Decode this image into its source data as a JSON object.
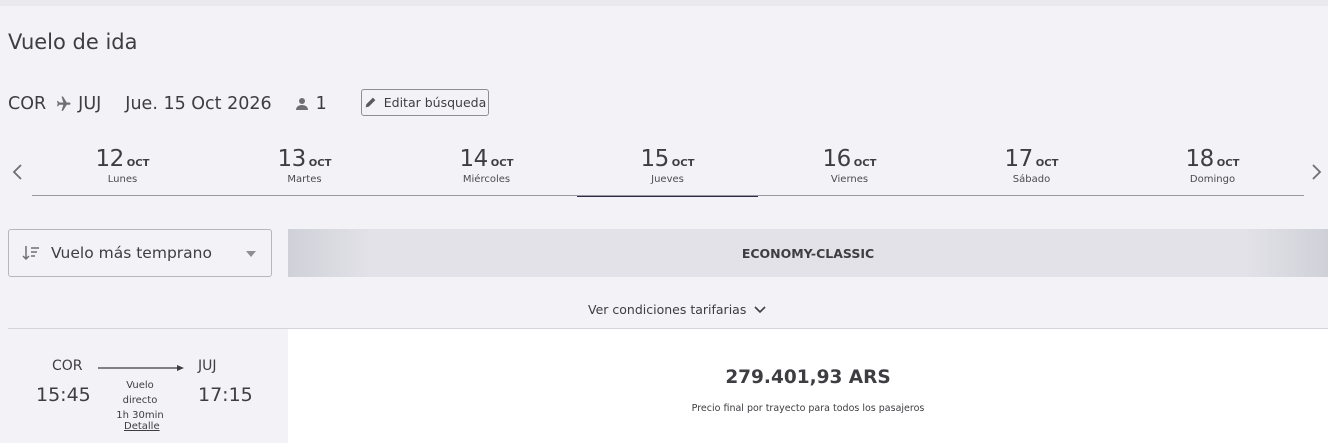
{
  "page": {
    "title": "Vuelo de ida"
  },
  "search": {
    "origin": "COR",
    "destination": "JUJ",
    "date": "Jue. 15 Oct 2026",
    "passengers": "1",
    "edit_label": "Editar búsqueda"
  },
  "dates": [
    {
      "day": "12",
      "month": "OCT",
      "weekday": "Lunes"
    },
    {
      "day": "13",
      "month": "OCT",
      "weekday": "Martes"
    },
    {
      "day": "14",
      "month": "OCT",
      "weekday": "Miércoles"
    },
    {
      "day": "15",
      "month": "OCT",
      "weekday": "Jueves",
      "selected": true
    },
    {
      "day": "16",
      "month": "OCT",
      "weekday": "Viernes"
    },
    {
      "day": "17",
      "month": "OCT",
      "weekday": "Sábado"
    },
    {
      "day": "18",
      "month": "OCT",
      "weekday": "Domingo"
    }
  ],
  "sort": {
    "selected": "Vuelo más temprano"
  },
  "fare_class": {
    "label": "ECONOMY-CLASSIC"
  },
  "conditions": {
    "label": "Ver condiciones tarifarias"
  },
  "flight": {
    "origin": "COR",
    "destination": "JUJ",
    "departure": "15:45",
    "arrival": "17:15",
    "type": "Vuelo directo",
    "duration": "1h 30min",
    "detail_label": "Detalle"
  },
  "fare": {
    "price": "279.401,93 ARS",
    "note": "Precio final por trayecto para todos los pasajeros"
  },
  "colors": {
    "background": "#f2f2f7",
    "text": "#3d3d42",
    "selected_underline": "#2d2a4a",
    "fare_card": "#ffffff"
  },
  "icons": [
    "plane-icon",
    "person-icon",
    "pencil-icon",
    "chevron-left-icon",
    "chevron-right-icon",
    "sort-icon",
    "caret-down-icon",
    "chevron-down-icon",
    "arrow-right-icon"
  ]
}
